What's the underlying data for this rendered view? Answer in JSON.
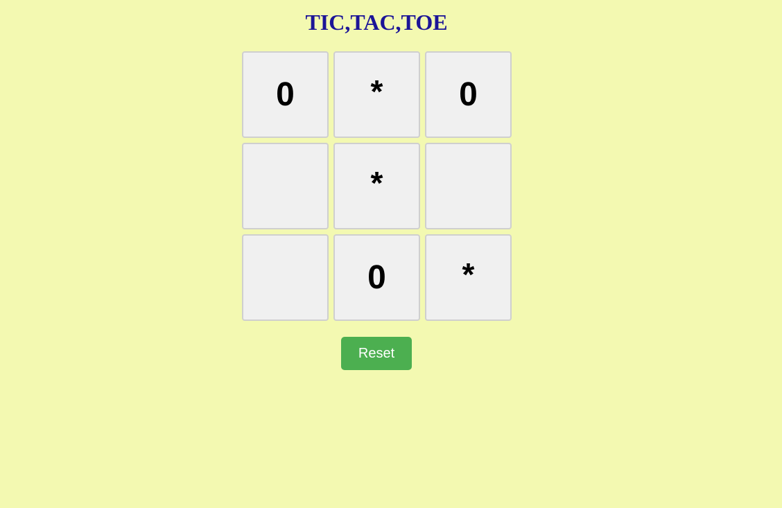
{
  "title": "TIC,TAC,TOE",
  "board": {
    "cells": [
      "0",
      "*",
      "0",
      "",
      "*",
      "",
      "",
      "0",
      "*"
    ]
  },
  "reset_label": "Reset",
  "colors": {
    "background": "#f3f9b1",
    "title": "#1c1597",
    "cell_bg": "#f0f0f0",
    "cell_border": "#cfcfcf",
    "reset_bg": "#4caf50",
    "reset_text": "#ffffff"
  }
}
